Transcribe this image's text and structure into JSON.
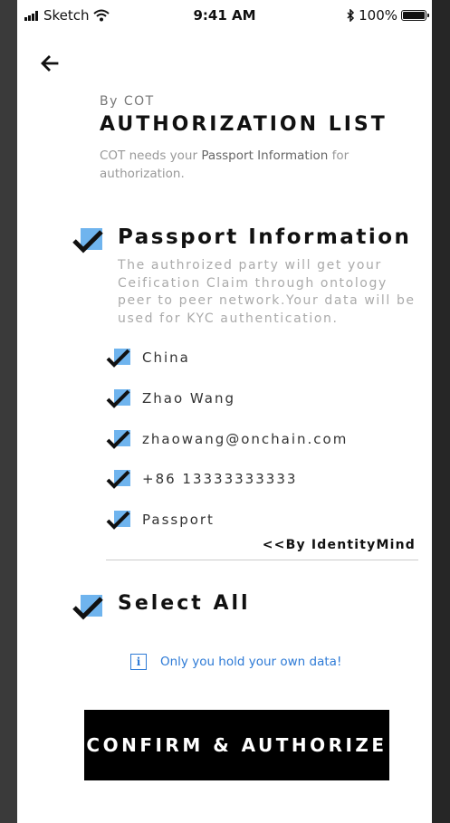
{
  "status_bar": {
    "carrier": "Sketch",
    "time": "9:41 AM",
    "battery_text": "100%",
    "battery_level": 1.0
  },
  "header": {
    "back_icon": "arrow-left-icon",
    "by_label": "By COT",
    "title": "AUTHORIZATION LIST",
    "intro_prefix": "COT needs your",
    "intro_highlight": "Passport Information",
    "intro_suffix": "for authorization."
  },
  "section": {
    "title": "Passport Information",
    "description": "The authroized party will get your Ceification Claim through ontology peer to peer network.Your data will be used for KYC authentication.",
    "checked": true
  },
  "items": [
    {
      "label": "China",
      "checked": true
    },
    {
      "label": "Zhao Wang",
      "checked": true
    },
    {
      "label": "zhaowang@onchain.com",
      "checked": true
    },
    {
      "label": "+86 13333333333",
      "checked": true
    },
    {
      "label": "Passport",
      "checked": true
    }
  ],
  "provider": "<<By IdentityMind",
  "select_all": {
    "label": "Select All",
    "checked": true
  },
  "info": {
    "icon": "info-icon",
    "text": "Only you hold your own data!"
  },
  "confirm_button": "CONFIRM & AUTHORIZE",
  "colors": {
    "check_fill": "#6fb4ee",
    "check_mark": "#111111",
    "info_blue": "#2d7ad6",
    "button_bg": "#000000"
  }
}
